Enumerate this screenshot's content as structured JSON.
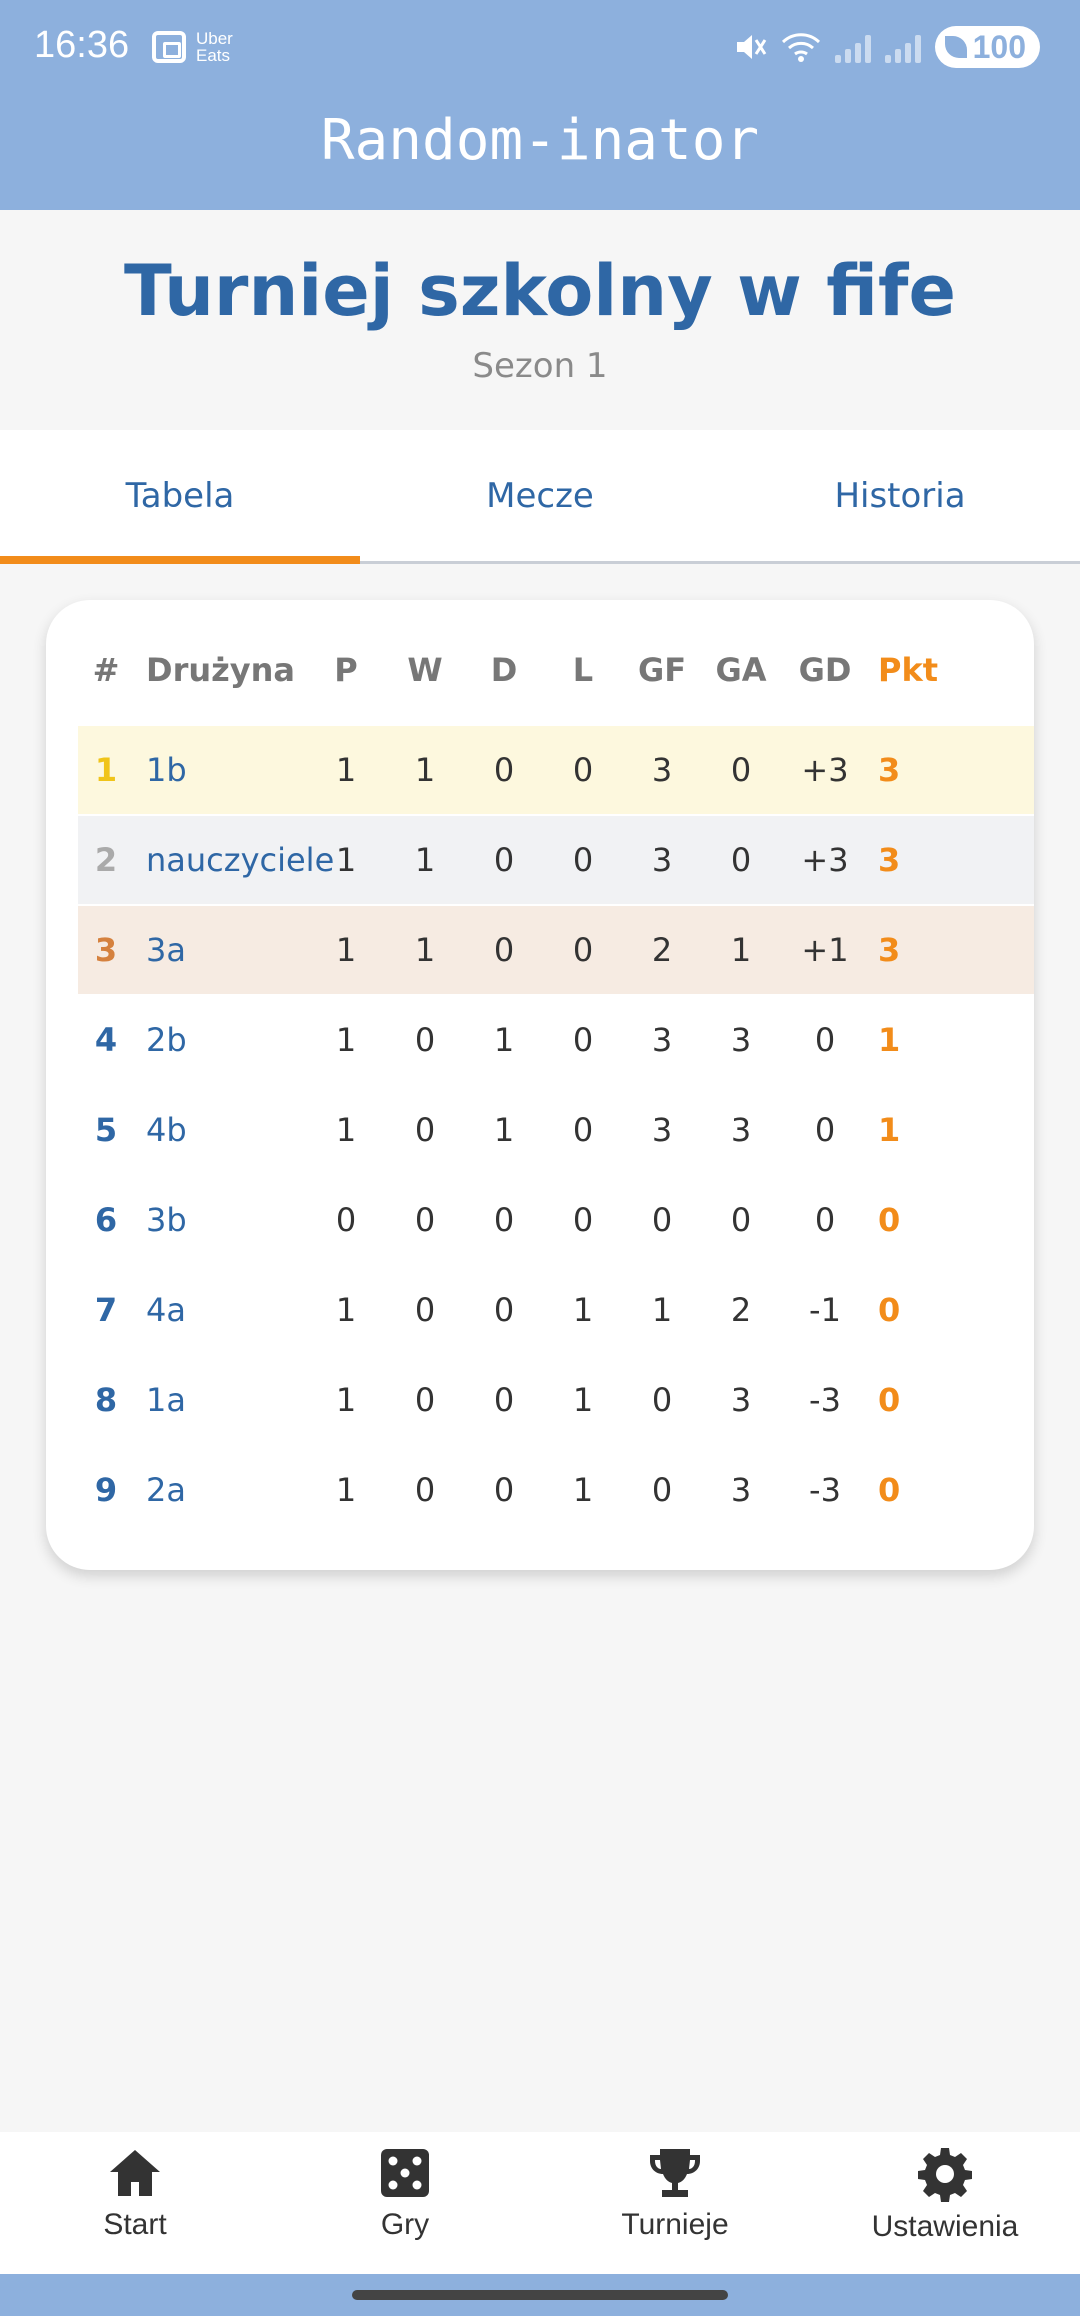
{
  "status": {
    "time": "16:36",
    "uber_line1": "Uber",
    "uber_line2": "Eats",
    "battery": "100"
  },
  "app": {
    "title": "Random-inator"
  },
  "tournament": {
    "title": "Turniej szkolny w fife",
    "season": "Sezon 1"
  },
  "tabs": [
    {
      "label": "Tabela"
    },
    {
      "label": "Mecze"
    },
    {
      "label": "Historia"
    }
  ],
  "table": {
    "headers": {
      "rank": "#",
      "team": "Drużyna",
      "p": "P",
      "w": "W",
      "d": "D",
      "l": "L",
      "gf": "GF",
      "ga": "GA",
      "gd": "GD",
      "pts": "Pkt"
    },
    "rows": [
      {
        "rank": "1",
        "team": "1b",
        "p": "1",
        "w": "1",
        "d": "0",
        "l": "0",
        "gf": "3",
        "ga": "0",
        "gd": "+3",
        "pts": "3"
      },
      {
        "rank": "2",
        "team": "nauczyciele",
        "p": "1",
        "w": "1",
        "d": "0",
        "l": "0",
        "gf": "3",
        "ga": "0",
        "gd": "+3",
        "pts": "3"
      },
      {
        "rank": "3",
        "team": "3a",
        "p": "1",
        "w": "1",
        "d": "0",
        "l": "0",
        "gf": "2",
        "ga": "1",
        "gd": "+1",
        "pts": "3"
      },
      {
        "rank": "4",
        "team": "2b",
        "p": "1",
        "w": "0",
        "d": "1",
        "l": "0",
        "gf": "3",
        "ga": "3",
        "gd": "0",
        "pts": "1"
      },
      {
        "rank": "5",
        "team": "4b",
        "p": "1",
        "w": "0",
        "d": "1",
        "l": "0",
        "gf": "3",
        "ga": "3",
        "gd": "0",
        "pts": "1"
      },
      {
        "rank": "6",
        "team": "3b",
        "p": "0",
        "w": "0",
        "d": "0",
        "l": "0",
        "gf": "0",
        "ga": "0",
        "gd": "0",
        "pts": "0"
      },
      {
        "rank": "7",
        "team": "4a",
        "p": "1",
        "w": "0",
        "d": "0",
        "l": "1",
        "gf": "1",
        "ga": "2",
        "gd": "-1",
        "pts": "0"
      },
      {
        "rank": "8",
        "team": "1a",
        "p": "1",
        "w": "0",
        "d": "0",
        "l": "1",
        "gf": "0",
        "ga": "3",
        "gd": "-3",
        "pts": "0"
      },
      {
        "rank": "9",
        "team": "2a",
        "p": "1",
        "w": "0",
        "d": "0",
        "l": "1",
        "gf": "0",
        "ga": "3",
        "gd": "-3",
        "pts": "0"
      }
    ]
  },
  "nav": [
    {
      "label": "Start"
    },
    {
      "label": "Gry"
    },
    {
      "label": "Turnieje"
    },
    {
      "label": "Ustawienia"
    }
  ],
  "colors": {
    "accent": "#f28c1a",
    "primary": "#2f67a5",
    "appbar": "#8db0dd"
  }
}
